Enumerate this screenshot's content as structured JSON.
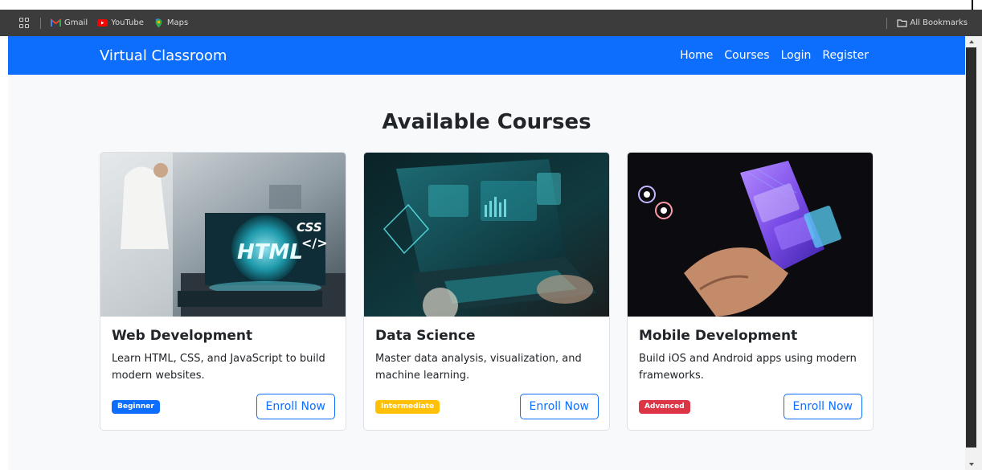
{
  "bookmarks_bar": {
    "items": [
      {
        "label": "Gmail",
        "icon": "gmail-icon"
      },
      {
        "label": "YouTube",
        "icon": "youtube-icon"
      },
      {
        "label": "Maps",
        "icon": "maps-icon"
      }
    ],
    "all_bookmarks": "All Bookmarks"
  },
  "navbar": {
    "brand": "Virtual Classroom",
    "links": [
      "Home",
      "Courses",
      "Login",
      "Register"
    ],
    "color": "#0d6efd"
  },
  "main": {
    "heading": "Available Courses",
    "courses": [
      {
        "title": "Web Development",
        "description": "Learn HTML, CSS, and JavaScript to build modern websites.",
        "level": "Beginner",
        "level_color": "#0d6efd",
        "button": "Enroll Now",
        "image_text": [
          "HTML",
          "CSS",
          "</>"
        ]
      },
      {
        "title": "Data Science",
        "description": "Master data analysis, visualization, and machine learning.",
        "level": "Intermediate",
        "level_color": "#ffc107",
        "button": "Enroll Now"
      },
      {
        "title": "Mobile Development",
        "description": "Build iOS and Android apps using modern frameworks.",
        "level": "Advanced",
        "level_color": "#dc3545",
        "button": "Enroll Now"
      }
    ]
  }
}
